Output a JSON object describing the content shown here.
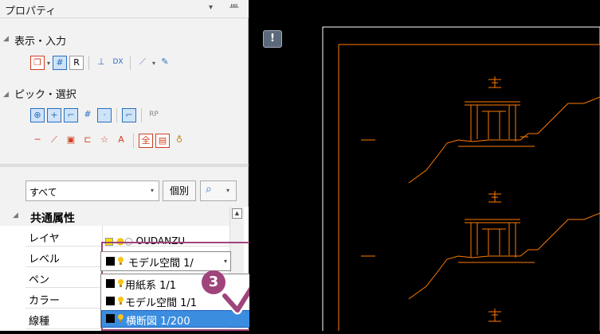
{
  "panel": {
    "title": "プロパティ",
    "pin_glyph": "▾ ‡",
    "section_display": "表示・入力",
    "section_pick": "ピック・選択"
  },
  "filter": {
    "value": "すべて",
    "individual_label": "個別"
  },
  "grid": {
    "category": "共通属性",
    "rows": [
      {
        "name": "レイヤ"
      },
      {
        "name": "レベル"
      },
      {
        "name": "ペン"
      },
      {
        "name": "カラー"
      },
      {
        "name": "線種"
      }
    ],
    "layer_value": "OUDANZU"
  },
  "level_combo": {
    "value": "モデル空間 1/"
  },
  "dropdown": {
    "options": [
      {
        "label": "用紙系 1/1"
      },
      {
        "label": "モデル空間 1/1"
      },
      {
        "label": "横断図 1/200"
      }
    ],
    "selected_index": 2
  },
  "annotation": {
    "step_number": "3",
    "accent_color": "#a0447c"
  },
  "cad": {
    "alert_label": "!",
    "line_color": "#ff7a00"
  }
}
